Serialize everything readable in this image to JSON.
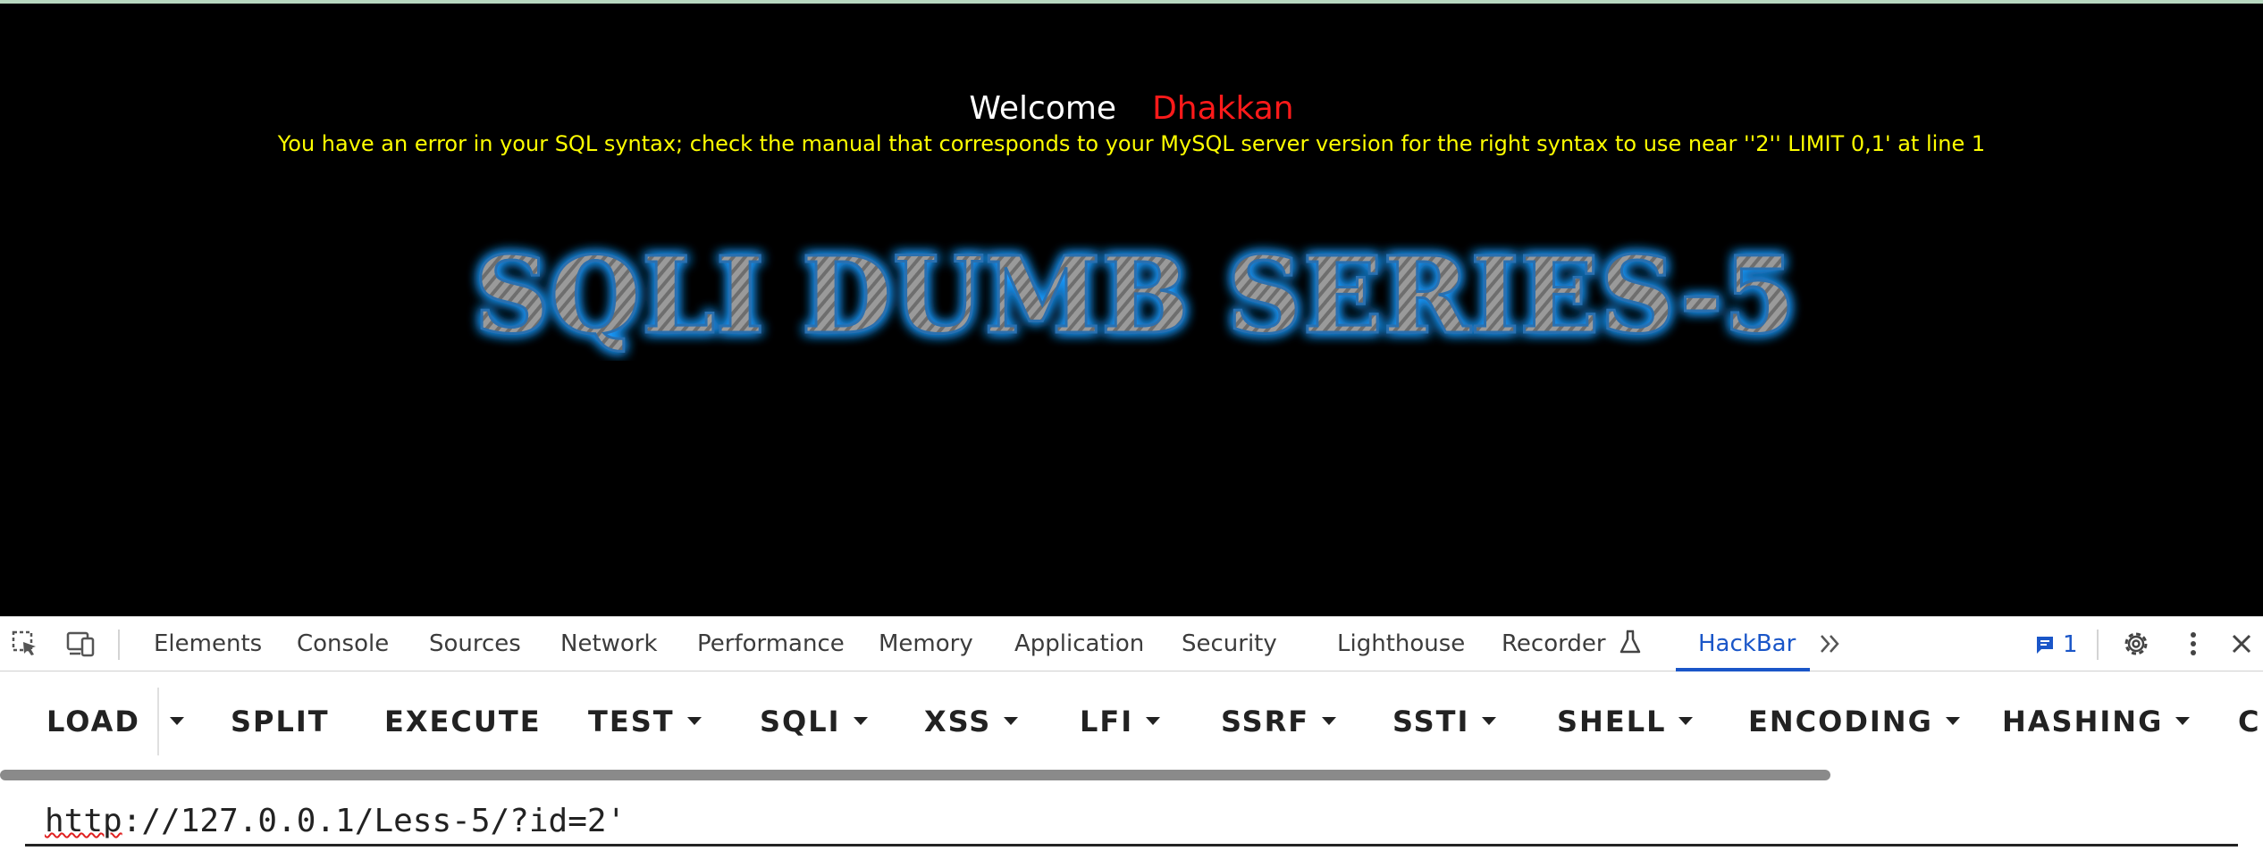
{
  "page": {
    "welcome_label": "Welcome",
    "user_name": "Dhakkan",
    "sql_error": "You have an error in your SQL syntax; check the manual that corresponds to your MySQL server version for the right syntax to use near ''2'' LIMIT 0,1' at line 1",
    "banner_text": "SQLI DUMB SERIES-5",
    "colors": {
      "background": "#000000",
      "welcome": "#ffffff",
      "user_name": "#ff1a1a",
      "error": "#ffff00",
      "banner_glow": "#1e9bff"
    }
  },
  "devtools": {
    "icons": [
      "inspect-element-icon",
      "device-toggle-icon"
    ],
    "tabs": [
      {
        "label": "Elements"
      },
      {
        "label": "Console"
      },
      {
        "label": "Sources"
      },
      {
        "label": "Network"
      },
      {
        "label": "Performance"
      },
      {
        "label": "Memory"
      },
      {
        "label": "Application"
      },
      {
        "label": "Security"
      },
      {
        "label": "Lighthouse"
      },
      {
        "label": "Recorder"
      },
      {
        "label": "HackBar",
        "active": true
      }
    ],
    "more_tabs_icon": "chevron-double-right-icon",
    "issues_count": "1",
    "accent_color": "#1a56c8"
  },
  "hackbar": {
    "buttons": [
      {
        "label": "LOAD",
        "dropdown": false
      },
      {
        "label": "SPLIT",
        "dropdown": false
      },
      {
        "label": "EXECUTE",
        "dropdown": false
      },
      {
        "label": "TEST",
        "dropdown": true
      },
      {
        "label": "SQLI",
        "dropdown": true
      },
      {
        "label": "XSS",
        "dropdown": true
      },
      {
        "label": "LFI",
        "dropdown": true
      },
      {
        "label": "SSRF",
        "dropdown": true
      },
      {
        "label": "SSTI",
        "dropdown": true
      },
      {
        "label": "SHELL",
        "dropdown": true
      },
      {
        "label": "ENCODING",
        "dropdown": true
      },
      {
        "label": "HASHING",
        "dropdown": true
      },
      {
        "label": "CU",
        "dropdown": false
      }
    ],
    "url_scheme": "http",
    "url_rest": "://127.0.0.1/Less-5/?id=2'"
  }
}
